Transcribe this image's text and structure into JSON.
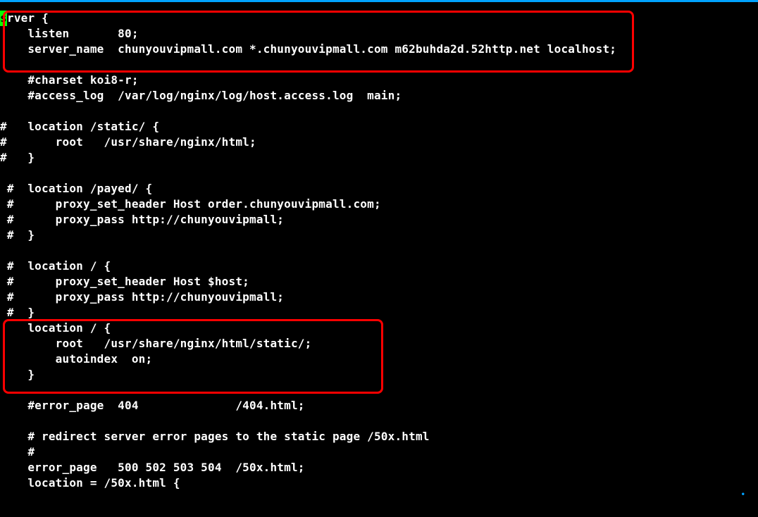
{
  "lines": {
    "l1_pre": "s",
    "l1_post": "rver {",
    "l2": "    listen       80;",
    "l3": "    server_name  chunyouvipmall.com *.chunyouvipmall.com m62buhda2d.52http.net localhost;",
    "l4": "",
    "l5": "    #charset koi8-r;",
    "l6": "    #access_log  /var/log/nginx/log/host.access.log  main;",
    "l7": "",
    "l8": "#   location /static/ {",
    "l9": "#       root   /usr/share/nginx/html;",
    "l10": "#   }",
    "l11": "",
    "l12": " #  location /payed/ {",
    "l13": " #      proxy_set_header Host order.chunyouvipmall.com;",
    "l14": " #      proxy_pass http://chunyouvipmall;",
    "l15": " #  }",
    "l16": "",
    "l17": " #  location / {",
    "l18": " #      proxy_set_header Host $host;",
    "l19": " #      proxy_pass http://chunyouvipmall;",
    "l20": " #  }",
    "l21": "    location / {",
    "l22": "        root   /usr/share/nginx/html/static/;",
    "l23": "        autoindex  on;",
    "l24": "    }",
    "l25": "",
    "l26": "    #error_page  404              /404.html;",
    "l27": "",
    "l28": "    # redirect server error pages to the static page /50x.html",
    "l29": "    #",
    "l30": "    error_page   500 502 503 504  /50x.html;",
    "l31": "    location = /50x.html {"
  },
  "collapse_marker": "•"
}
